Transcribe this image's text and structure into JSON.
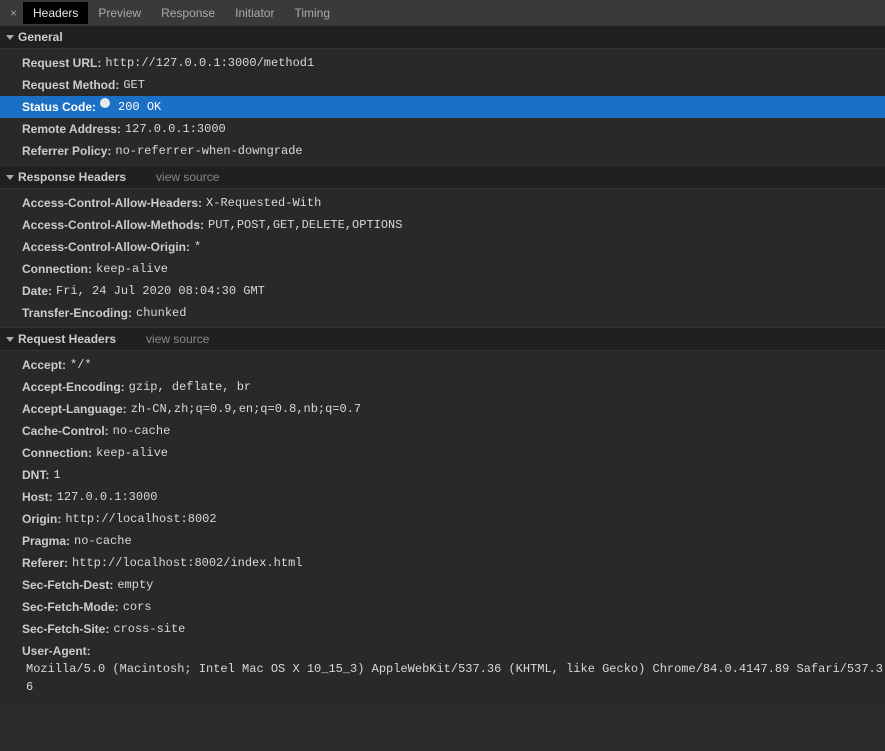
{
  "tabs": {
    "close": "×",
    "items": [
      "Headers",
      "Preview",
      "Response",
      "Initiator",
      "Timing"
    ],
    "active": 0
  },
  "sections": {
    "general": {
      "title": "General",
      "rows": [
        {
          "key": "Request URL:",
          "val": "http://127.0.0.1:3000/method1",
          "hl": false
        },
        {
          "key": "Request Method:",
          "val": "GET",
          "hl": false
        },
        {
          "key": "Status Code:",
          "val": "200 OK",
          "hl": true,
          "statusDot": true
        },
        {
          "key": "Remote Address:",
          "val": "127.0.0.1:3000",
          "hl": false
        },
        {
          "key": "Referrer Policy:",
          "val": "no-referrer-when-downgrade",
          "hl": false
        }
      ]
    },
    "response": {
      "title": "Response Headers",
      "viewSource": "view source",
      "rows": [
        {
          "key": "Access-Control-Allow-Headers:",
          "val": "X-Requested-With"
        },
        {
          "key": "Access-Control-Allow-Methods:",
          "val": "PUT,POST,GET,DELETE,OPTIONS"
        },
        {
          "key": "Access-Control-Allow-Origin:",
          "val": "*"
        },
        {
          "key": "Connection:",
          "val": "keep-alive"
        },
        {
          "key": "Date:",
          "val": "Fri, 24 Jul 2020 08:04:30 GMT"
        },
        {
          "key": "Transfer-Encoding:",
          "val": "chunked"
        }
      ]
    },
    "request": {
      "title": "Request Headers",
      "viewSource": "view source",
      "rows": [
        {
          "key": "Accept:",
          "val": "*/*"
        },
        {
          "key": "Accept-Encoding:",
          "val": "gzip, deflate, br"
        },
        {
          "key": "Accept-Language:",
          "val": "zh-CN,zh;q=0.9,en;q=0.8,nb;q=0.7"
        },
        {
          "key": "Cache-Control:",
          "val": "no-cache"
        },
        {
          "key": "Connection:",
          "val": "keep-alive"
        },
        {
          "key": "DNT:",
          "val": "1"
        },
        {
          "key": "Host:",
          "val": "127.0.0.1:3000"
        },
        {
          "key": "Origin:",
          "val": "http://localhost:8002"
        },
        {
          "key": "Pragma:",
          "val": "no-cache"
        },
        {
          "key": "Referer:",
          "val": "http://localhost:8002/index.html"
        },
        {
          "key": "Sec-Fetch-Dest:",
          "val": "empty"
        },
        {
          "key": "Sec-Fetch-Mode:",
          "val": "cors"
        },
        {
          "key": "Sec-Fetch-Site:",
          "val": "cross-site"
        },
        {
          "key": "User-Agent:",
          "val": "Mozilla/5.0 (Macintosh; Intel Mac OS X 10_15_3) AppleWebKit/537.36 (KHTML, like Gecko) Chrome/84.0.4147.89 Safari/537.36"
        }
      ]
    }
  }
}
